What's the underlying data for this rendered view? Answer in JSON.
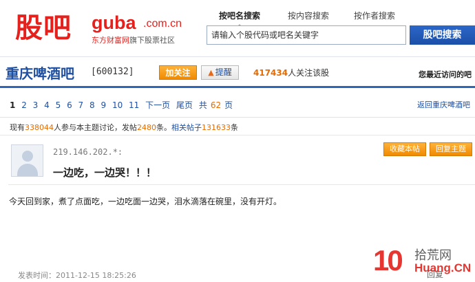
{
  "header": {
    "logo_text": "股吧",
    "logo_site": "guba",
    "logo_domain": ".com.cn",
    "logo_sub_red": "东方财富网",
    "logo_sub_rest": "旗下股票社区",
    "tabs": [
      {
        "label": "按吧名搜索",
        "active": true
      },
      {
        "label": "按内容搜索",
        "active": false
      },
      {
        "label": "按作者搜索",
        "active": false
      }
    ],
    "search_placeholder": "请输入个股代码或吧名关键字",
    "search_button": "股吧搜索"
  },
  "bar": {
    "name": "重庆啤酒吧",
    "code": "[600132]",
    "follow_button": "加关注",
    "remind_button": "提醒",
    "followers_count": "417434",
    "followers_suffix": "人关注该股",
    "recent_visit": "您最近访问的吧"
  },
  "pager": {
    "current": "1",
    "pages": [
      "2",
      "3",
      "4",
      "5",
      "6",
      "7",
      "8",
      "9",
      "10",
      "11"
    ],
    "next": "下一页",
    "last": "尾页",
    "total_prefix": "共",
    "total_pages": "62",
    "total_suffix": "页",
    "back_link": "返回重庆啤酒吧"
  },
  "stats": {
    "p1": "现有",
    "participants": "338044",
    "p2": "人参与本主题讨论，发帖",
    "posts": "2480",
    "p3": "条。",
    "related_label": "相关帖子",
    "related": "131633",
    "p4": "条"
  },
  "post": {
    "ip": "219.146.202.*:",
    "title": "一边吃，一边哭！！！",
    "favorite_button": "收藏本帖",
    "reply_button": "回复主题",
    "body": "今天回到家，煮了点面吃，一边吃面一边哭，泪水滴落在碗里，没有开灯。",
    "time": "发表时间：2011-12-15 18:25:26",
    "reply_link": "回复"
  },
  "watermark": {
    "num": "10",
    "cn": "拾荒网",
    "en": "Huang.CN"
  },
  "colors": {
    "brand_red": "#e4211c",
    "link_blue": "#1f4fa0",
    "accent_orange": "#e66b00",
    "search_blue": "#2b67c8"
  }
}
